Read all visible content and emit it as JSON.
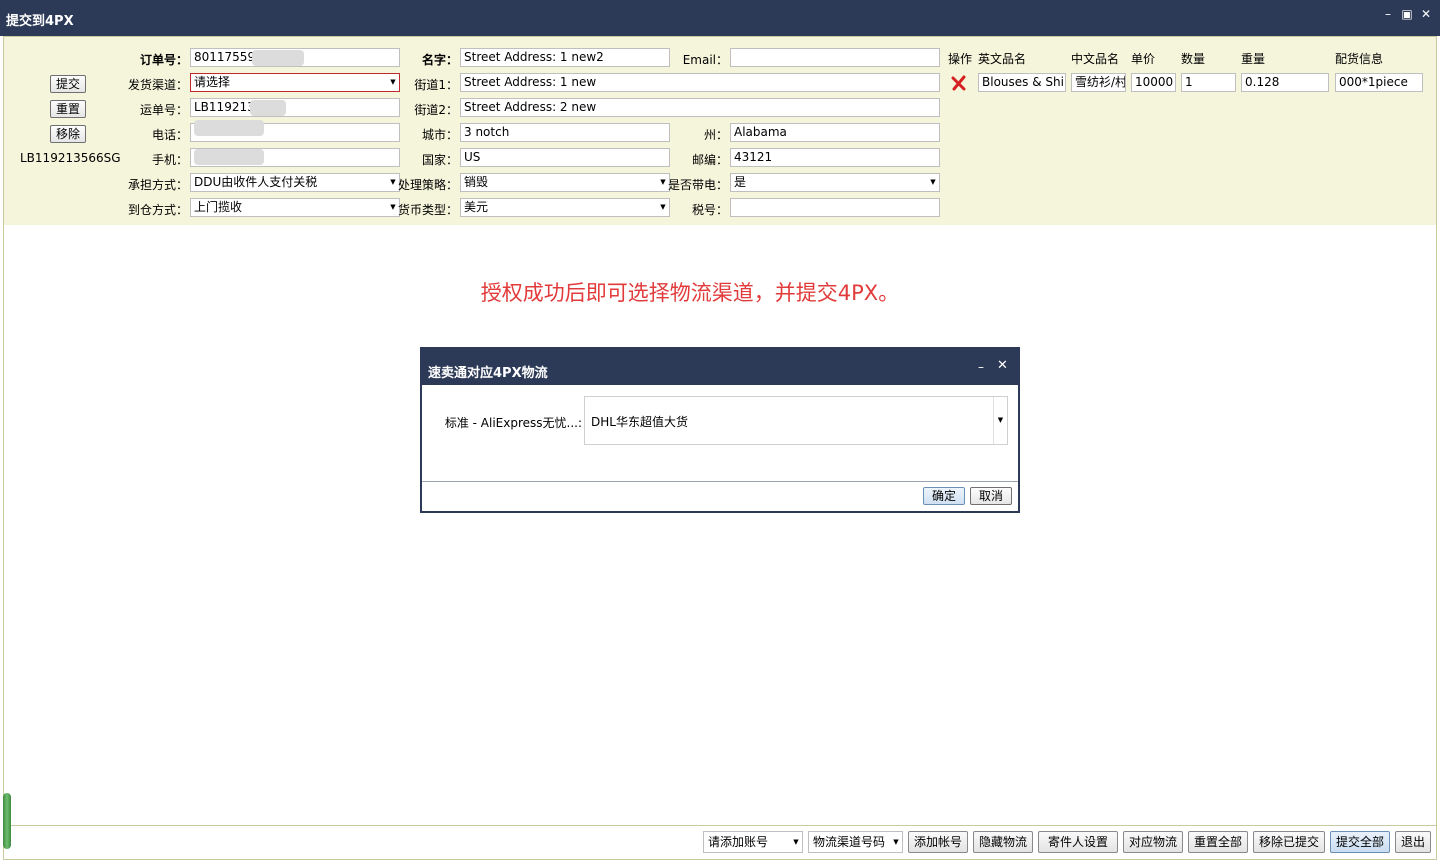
{
  "window": {
    "title": "提交到4PX",
    "minimize": "–",
    "restore": "▣",
    "close": "✕"
  },
  "left_buttons": {
    "submit": "提交",
    "reset": "重置",
    "remove": "移除",
    "tracking_no": "LB119213566SG"
  },
  "form": {
    "order_no_label": "订单号：",
    "order_no_value": "801175590",
    "channel_label": "发货渠道：",
    "channel_value": "请选择",
    "waybill_label": "运单号：",
    "waybill_value": "LB119213",
    "phone_label": "电话：",
    "phone_value": "",
    "mobile_label": "手机：",
    "mobile_value": "",
    "bear_label": "承担方式：",
    "bear_value": "DDU由收件人支付关税",
    "warehouse_label": "到仓方式：",
    "warehouse_value": "上门揽收",
    "name_label": "名字：",
    "name_value": "Street Address: 1 new2",
    "street1_label": "街道1：",
    "street1_value": "Street Address: 1 new",
    "street2_label": "街道2：",
    "street2_value": "Street Address: 2 new",
    "city_label": "城市：",
    "city_value": "3 notch",
    "country_label": "国家：",
    "country_value": "US",
    "policy_label": "处理策略：",
    "policy_value": "销毁",
    "currency_label": "货币类型：",
    "currency_value": "美元",
    "email_label": "Email：",
    "email_value": "",
    "state_label": "州：",
    "state_value": "Alabama",
    "zip_label": "邮编：",
    "zip_value": "43121",
    "battery_label": "是否带电：",
    "battery_value": "是",
    "tax_label": "税号：",
    "tax_value": ""
  },
  "items": {
    "headers": {
      "op": "操作",
      "en_name": "英文品名",
      "cn_name": "中文品名",
      "price": "单价",
      "qty": "数量",
      "weight": "重量",
      "spec": "配货信息"
    },
    "row": {
      "en_name": "Blouses & Shir",
      "cn_name": "雪纺衫/村",
      "price": "10000",
      "qty": "1",
      "weight": "0.128",
      "spec": "000*1piece"
    }
  },
  "message": "授权成功后即可选择物流渠道，并提交4PX。",
  "dialog": {
    "title": "速卖通对应4PX物流",
    "minimize": "–",
    "close": "✕",
    "field_label": "标准 - AliExpress无忧...:",
    "field_value": "DHL华东超值大货",
    "ok": "确定",
    "cancel": "取消"
  },
  "bottom": {
    "account_select": "请添加账号",
    "channel_code_select": "物流渠道号码",
    "add_account": "添加帐号",
    "hide_logistics": "隐藏物流",
    "sender_settings": "寄件人设置",
    "map_logistics": "对应物流",
    "reset_all": "重置全部",
    "remove_submitted": "移除已提交",
    "submit_all": "提交全部",
    "exit": "退出"
  },
  "colors": {
    "titlebar": "#2c3a57",
    "form_bg": "#f5f5dc",
    "message": "#e23b3b",
    "error_border": "#c0282d"
  }
}
